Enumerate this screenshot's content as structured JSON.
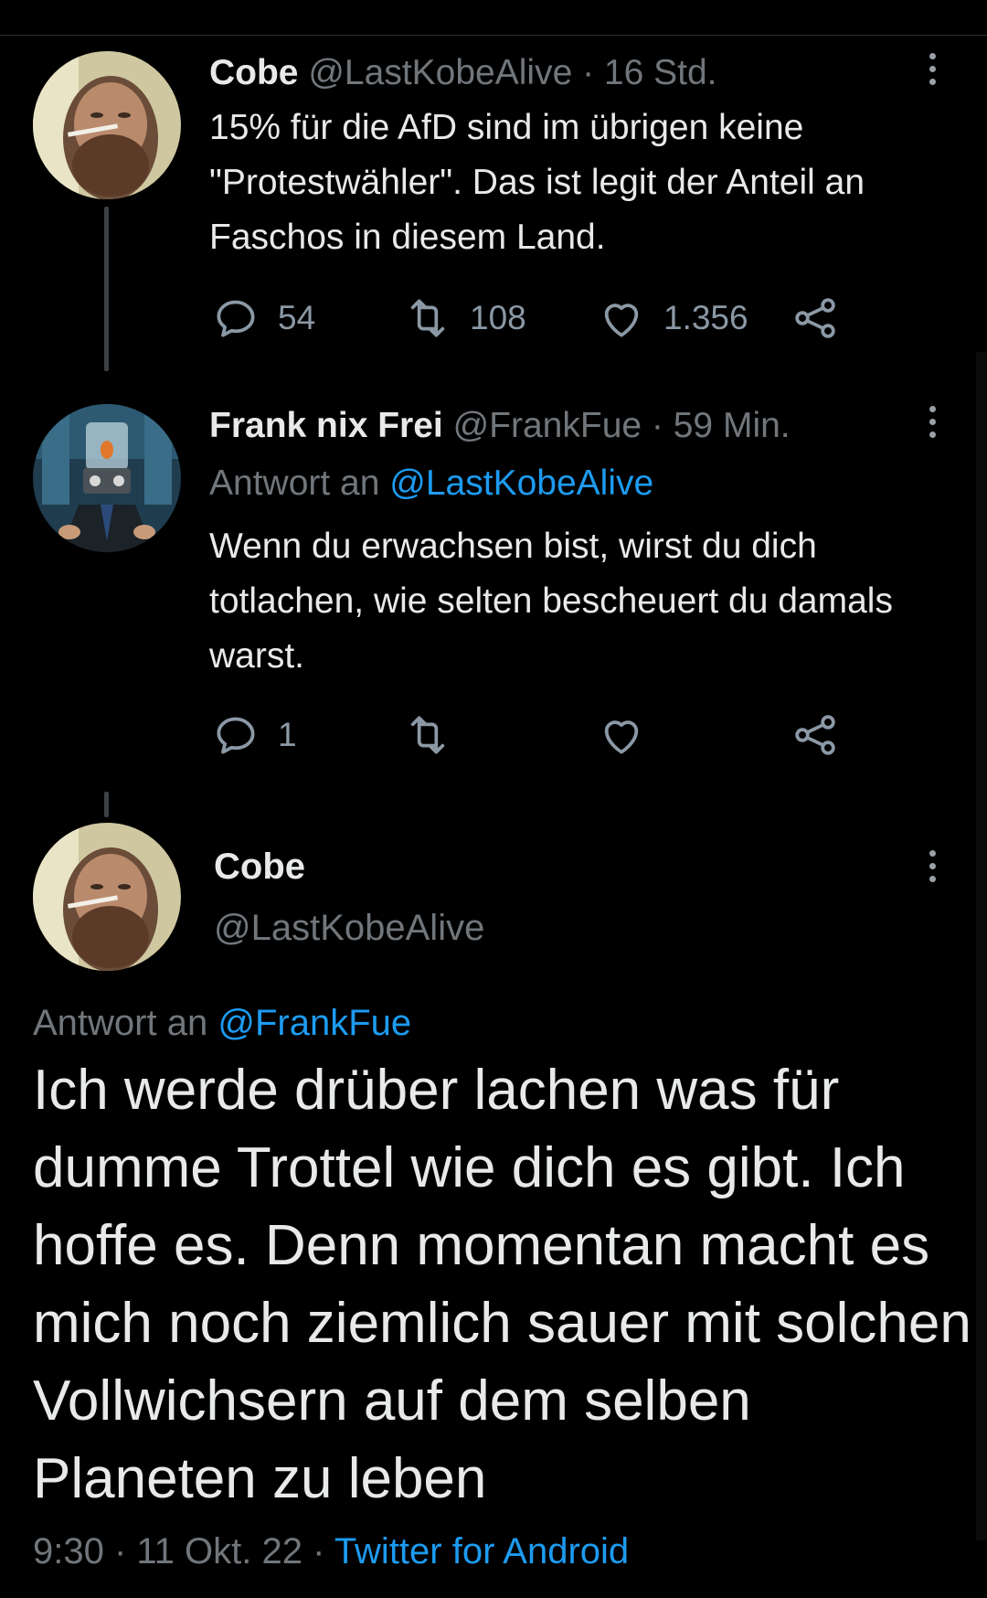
{
  "tweet1": {
    "name": "Cobe",
    "handle": "@LastKobeAlive",
    "time": "· 16 Std.",
    "text": "15% für die AfD sind im übrigen keine \"Protestwähler\". Das ist legit der Anteil an Faschos in diesem Land.",
    "replies": "54",
    "retweets": "108",
    "likes": "1.356"
  },
  "tweet2": {
    "name": "Frank nix Frei",
    "handle": "@FrankFue",
    "time": "· 59 Min.",
    "reply_prefix": "Antwort an",
    "reply_handle": "@LastKobeAlive",
    "text": "Wenn du erwachsen bist, wirst du dich totlachen, wie selten bescheuert du damals warst.",
    "replies": "1"
  },
  "tweet3": {
    "name": "Cobe",
    "handle": "@LastKobeAlive",
    "reply_prefix": "Antwort an",
    "reply_handle": "@FrankFue",
    "text": "Ich werde drüber lachen was für dumme Trottel wie dich es gibt. Ich hoffe es. Denn momentan macht es mich noch ziemlich sauer mit solchen Vollwichsern auf dem selben Planeten zu leben",
    "timestamp": "9:30 · 11 Okt. 22 ·",
    "source": "Twitter for Android"
  },
  "colors": {
    "link": "#1d9bf0",
    "muted": "#71767b",
    "text": "#e7e9ea",
    "background": "#000000"
  },
  "icons": [
    "reply-icon",
    "retweet-icon",
    "like-icon",
    "share-icon",
    "more-icon"
  ]
}
